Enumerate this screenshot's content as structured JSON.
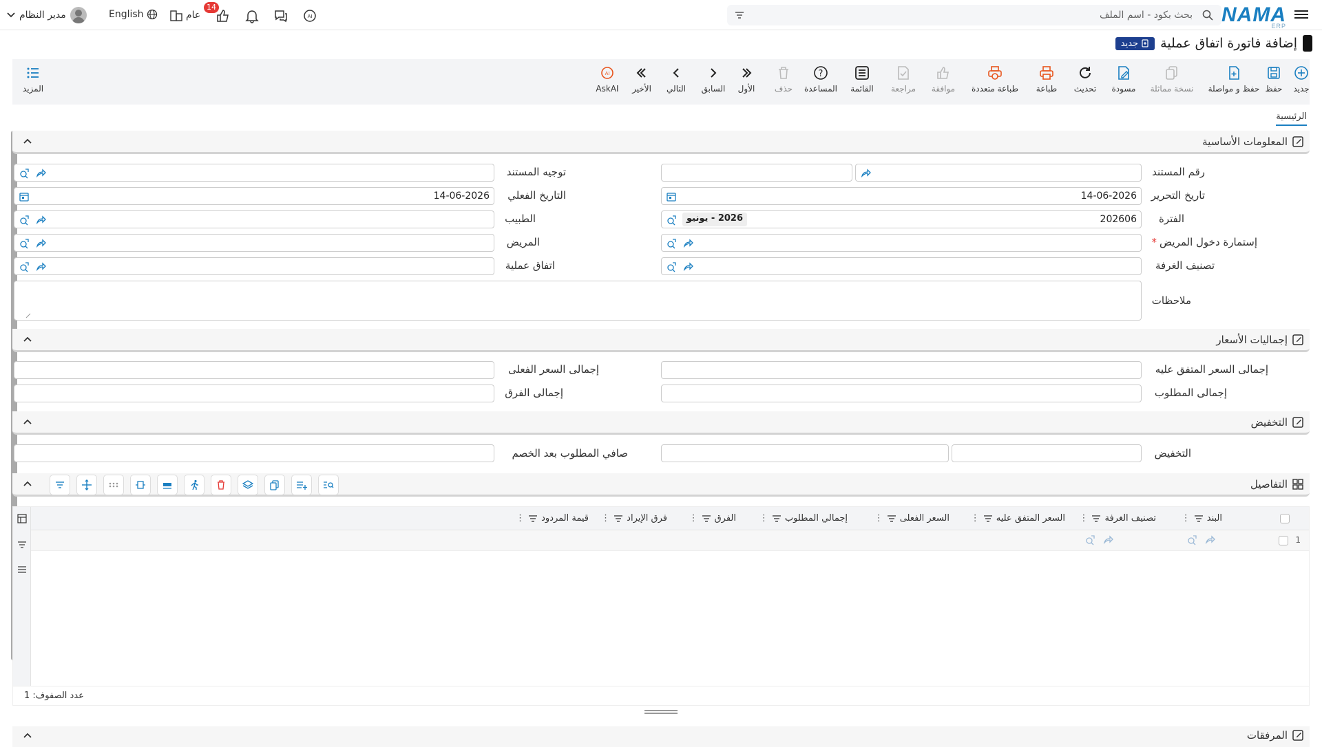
{
  "header": {
    "logo": "NAMA",
    "logo_sub": "ERP",
    "search_placeholder": "بحث بكود - اسم الملف",
    "user_name": "مدير النظام",
    "language": "English",
    "public_label": "عام",
    "notification_count": "14"
  },
  "page": {
    "title": "إضافة فاتورة اتفاق عملية",
    "status_badge": "جديد"
  },
  "toolbar": [
    {
      "label": "جديد",
      "icon": "plus-circle-icon",
      "enabled": true
    },
    {
      "label": "حفظ",
      "icon": "save-icon",
      "enabled": true
    },
    {
      "label": "حفظ و مواصلة",
      "icon": "save-continue-icon",
      "enabled": true
    },
    {
      "label": "نسخة مماثلة",
      "icon": "copy-icon",
      "enabled": false
    },
    {
      "label": "مسودة",
      "icon": "draft-icon",
      "enabled": true
    },
    {
      "label": "تحديث",
      "icon": "refresh-icon",
      "enabled": true
    },
    {
      "label": "طباعة",
      "icon": "print-icon",
      "enabled": true
    },
    {
      "label": "طباعة متعددة",
      "icon": "multi-print-icon",
      "enabled": true
    },
    {
      "label": "موافقة",
      "icon": "approve-icon",
      "enabled": false
    },
    {
      "label": "مراجعة",
      "icon": "review-icon",
      "enabled": false
    },
    {
      "label": "القائمة",
      "icon": "list-icon",
      "enabled": true
    },
    {
      "label": "المساعدة",
      "icon": "help-icon",
      "enabled": true
    },
    {
      "label": "حذف",
      "icon": "trash-icon",
      "enabled": false
    },
    {
      "label": "الأول",
      "icon": "first-icon",
      "enabled": true
    },
    {
      "label": "السابق",
      "icon": "previous-icon",
      "enabled": true
    },
    {
      "label": "التالي",
      "icon": "next-icon",
      "enabled": true
    },
    {
      "label": "الأخير",
      "icon": "last-icon",
      "enabled": true
    },
    {
      "label": "AskAI",
      "icon": "ai-icon",
      "enabled": true
    }
  ],
  "more_label": "المزيد",
  "tabs": [
    "الرئيسية"
  ],
  "sections": {
    "basic": "المعلومات الأساسية",
    "totals": "إجماليات الأسعار",
    "discount": "التخفيض",
    "details": "التفاصيل",
    "attachments": "المرفقات"
  },
  "basic_fields": {
    "doc_number": {
      "label": "رقم المستند",
      "value": ""
    },
    "doc_direction": {
      "label": "توجيه المستند",
      "value": ""
    },
    "edit_date": {
      "label": "تاريخ التحرير",
      "value": "14-06-2026"
    },
    "actual_date": {
      "label": "التاريخ الفعلي",
      "value": "14-06-2026"
    },
    "period": {
      "label": "الفترة",
      "value": "202606",
      "chip": "2026 - يونيو"
    },
    "doctor": {
      "label": "الطبيب",
      "value": ""
    },
    "admission_form": {
      "label": "إستمارة دخول المريض",
      "value": "",
      "required": "*"
    },
    "patient": {
      "label": "المريض",
      "value": ""
    },
    "room_class": {
      "label": "تصنيف الغرفة",
      "value": ""
    },
    "operation_agreement": {
      "label": "اتفاق عملية",
      "value": ""
    },
    "notes": {
      "label": "ملاحظات",
      "value": ""
    }
  },
  "totals_fields": {
    "agreed_total": {
      "label": "إجمالى السعر المتفق عليه",
      "value": ""
    },
    "actual_total": {
      "label": "إجمالى السعر الفعلى",
      "value": ""
    },
    "required_total": {
      "label": "إجمالى المطلوب",
      "value": ""
    },
    "diff_total": {
      "label": "إجمالى الفرق",
      "value": ""
    }
  },
  "discount_fields": {
    "discount": {
      "label": "التخفيض",
      "value": ""
    },
    "net_required": {
      "label": "صافي المطلوب بعد الخصم",
      "value": ""
    }
  },
  "grid": {
    "columns": [
      "البند",
      "تصنيف الغرفة",
      "السعر المتفق عليه",
      "السعر الفعلى",
      "إجمالي المطلوب",
      "الفرق",
      "فرق الإيراد",
      "قيمة المردود"
    ],
    "rows": [
      {
        "index": "1"
      }
    ],
    "footer": "عدد الصفوف: 1"
  }
}
